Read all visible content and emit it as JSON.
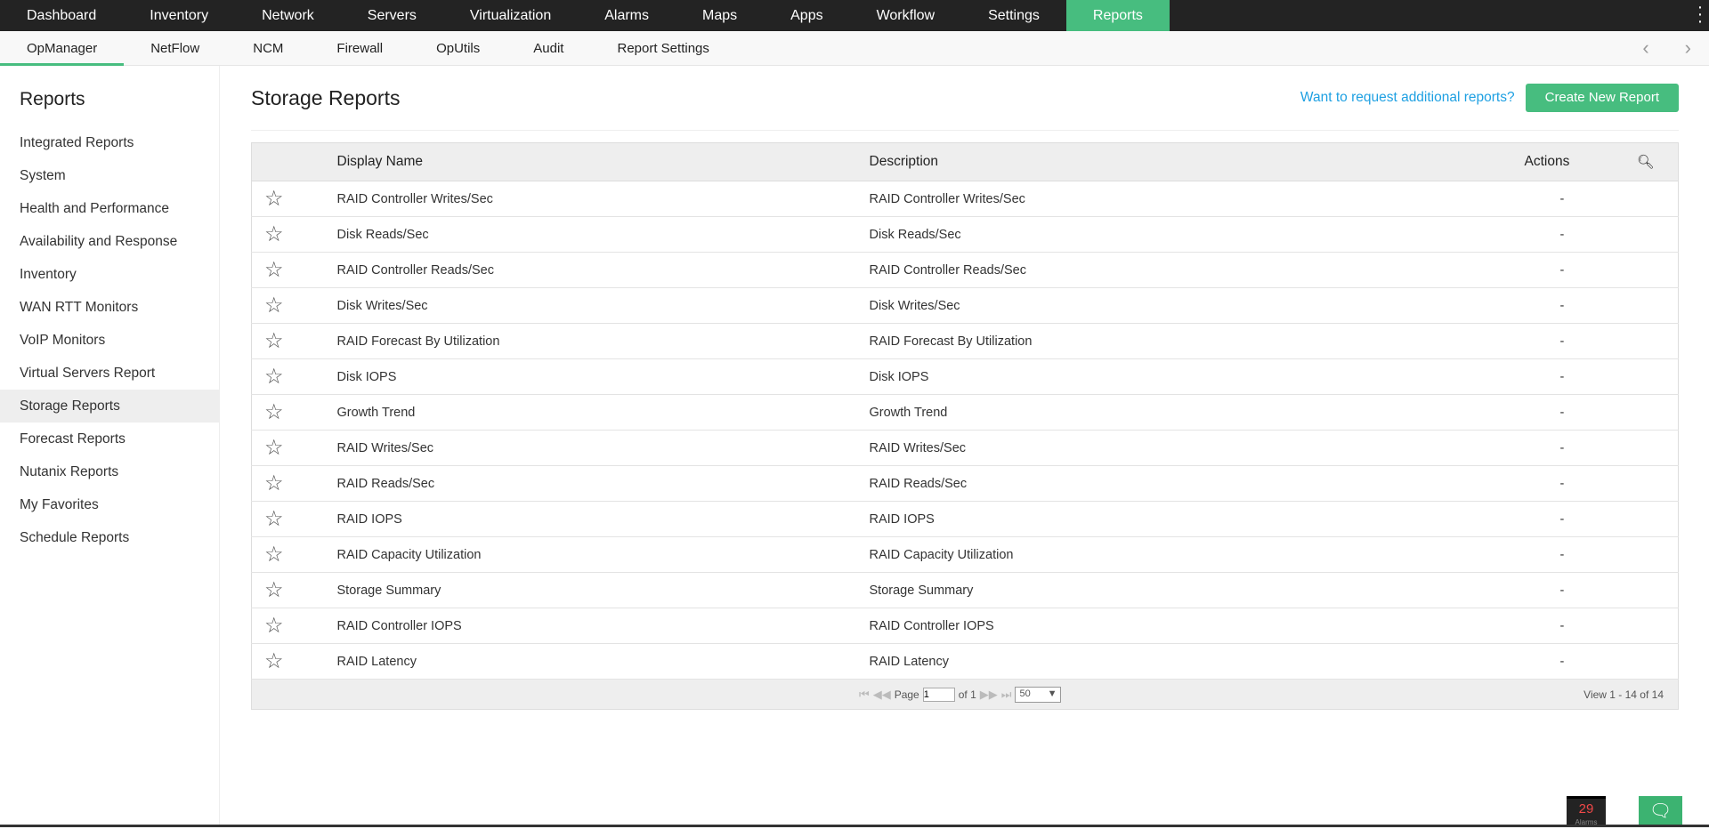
{
  "topnav": [
    "Dashboard",
    "Inventory",
    "Network",
    "Servers",
    "Virtualization",
    "Alarms",
    "Maps",
    "Apps",
    "Workflow",
    "Settings",
    "Reports"
  ],
  "subnav": [
    "OpManager",
    "NetFlow",
    "NCM",
    "Firewall",
    "OpUtils",
    "Audit",
    "Report Settings"
  ],
  "sidebar": {
    "title": "Reports",
    "items": [
      "Integrated Reports",
      "System",
      "Health and Performance",
      "Availability and Response",
      "Inventory",
      "WAN RTT Monitors",
      "VoIP Monitors",
      "Virtual Servers Report",
      "Storage Reports",
      "Forecast Reports",
      "Nutanix Reports",
      "My Favorites",
      "Schedule Reports"
    ]
  },
  "main": {
    "title": "Storage Reports",
    "request_link": "Want to request additional reports?",
    "create_button": "Create New Report"
  },
  "table": {
    "headers": {
      "name": "Display Name",
      "description": "Description",
      "actions": "Actions"
    },
    "rows": [
      {
        "name": "RAID Controller Writes/Sec",
        "description": "RAID Controller Writes/Sec",
        "actions": "-"
      },
      {
        "name": "Disk Reads/Sec",
        "description": "Disk Reads/Sec",
        "actions": "-"
      },
      {
        "name": "RAID Controller Reads/Sec",
        "description": "RAID Controller Reads/Sec",
        "actions": "-"
      },
      {
        "name": "Disk Writes/Sec",
        "description": "Disk Writes/Sec",
        "actions": "-"
      },
      {
        "name": "RAID Forecast By Utilization",
        "description": "RAID Forecast By Utilization",
        "actions": "-"
      },
      {
        "name": "Disk IOPS",
        "description": "Disk IOPS",
        "actions": "-"
      },
      {
        "name": "Growth Trend",
        "description": "Growth Trend",
        "actions": "-"
      },
      {
        "name": "RAID Writes/Sec",
        "description": "RAID Writes/Sec",
        "actions": "-"
      },
      {
        "name": "RAID Reads/Sec",
        "description": "RAID Reads/Sec",
        "actions": "-"
      },
      {
        "name": "RAID IOPS",
        "description": "RAID IOPS",
        "actions": "-"
      },
      {
        "name": "RAID Capacity Utilization",
        "description": "RAID Capacity Utilization",
        "actions": "-"
      },
      {
        "name": "Storage Summary",
        "description": "Storage Summary",
        "actions": "-"
      },
      {
        "name": "RAID Controller IOPS",
        "description": "RAID Controller IOPS",
        "actions": "-"
      },
      {
        "name": "RAID Latency",
        "description": "RAID Latency",
        "actions": "-"
      }
    ]
  },
  "pager": {
    "page_label": "Page",
    "page": "1",
    "of": "of 1",
    "page_size": "50",
    "view": "View 1 - 14 of 14"
  },
  "alarms": {
    "count": "29",
    "label": "Alarms"
  },
  "colors": {
    "accent": "#47bd7f",
    "nav_bg": "#232323",
    "link": "#1ea0e2"
  }
}
